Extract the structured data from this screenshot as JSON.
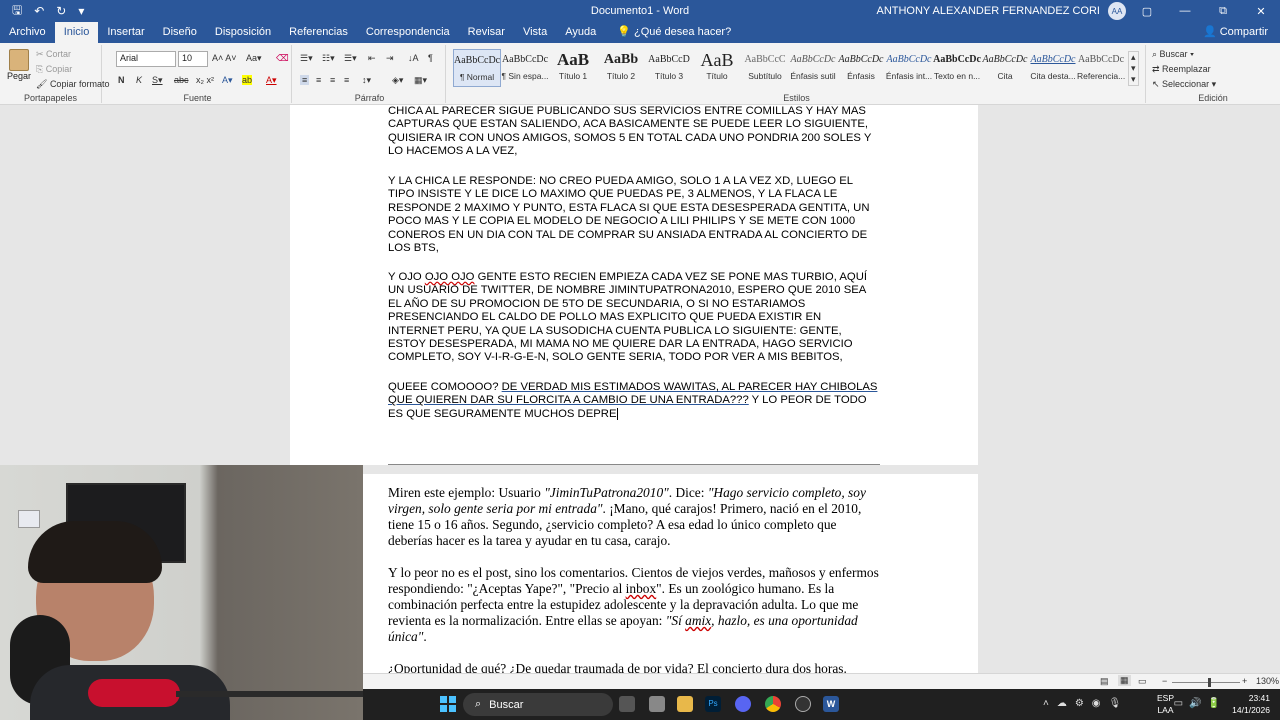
{
  "window": {
    "title": "Documento1 - Word",
    "user": "ANTHONY ALEXANDER FERNANDEZ CORI",
    "avatar": "AA",
    "controls": {
      "restore": "▢",
      "minimize": "—",
      "maximize": "⧉",
      "close": "✕"
    }
  },
  "ribbon_tabs": [
    "Archivo",
    "Inicio",
    "Insertar",
    "Diseño",
    "Disposición",
    "Referencias",
    "Correspondencia",
    "Revisar",
    "Vista",
    "Ayuda"
  ],
  "tell_me": "¿Qué desea hacer?",
  "share": "Compartir",
  "clipboard": {
    "paste": "Pegar",
    "cut": "Cortar",
    "copy": "Copiar",
    "format_painter": "Copiar formato",
    "label": "Portapapeles"
  },
  "font": {
    "name": "Arial",
    "size": "10",
    "label": "Fuente"
  },
  "paragraph": {
    "label": "Párrafo"
  },
  "styles": {
    "label": "Estilos",
    "items": [
      {
        "preview": "AaBbCcDc",
        "name": "¶ Normal"
      },
      {
        "preview": "AaBbCcDc",
        "name": "¶ Sin espa..."
      },
      {
        "preview": "AaB",
        "name": "Título 1"
      },
      {
        "preview": "AaBb",
        "name": "Título 2"
      },
      {
        "preview": "AaBbCcD",
        "name": "Título 3"
      },
      {
        "preview": "AaB",
        "name": "Título"
      },
      {
        "preview": "AaBbCcC",
        "name": "Subtítulo"
      },
      {
        "preview": "AaBbCcDc",
        "name": "Énfasis sutil"
      },
      {
        "preview": "AaBbCcDc",
        "name": "Énfasis"
      },
      {
        "preview": "AaBbCcDc",
        "name": "Énfasis int..."
      },
      {
        "preview": "AaBbCcDc",
        "name": "Texto en n..."
      },
      {
        "preview": "AaBbCcDc",
        "name": "Cita"
      },
      {
        "preview": "AaBbCcDc",
        "name": "Cita desta..."
      },
      {
        "preview": "AaBbCcDc",
        "name": "Referencia..."
      }
    ]
  },
  "editing": {
    "find": "Buscar",
    "replace": "Reemplazar",
    "select": "Seleccionar",
    "label": "Edición"
  },
  "page1": {
    "para1": "CHICA AL PARECER SIGUE PUBLICANDO SUS SERVICIOS ENTRE COMILLAS Y HAY MAS CAPTURAS QUE ESTAN SALIENDO, ACA BASICAMENTE SE PUEDE LEER LO SIGUIENTE, QUISIERA IR CON UNOS AMIGOS, SOMOS 5 EN TOTAL CADA UNO PONDRIA 200 SOLES Y LO HACEMOS A LA VEZ,",
    "para2": "Y LA CHICA LE RESPONDE: NO CREO PUEDA AMIGO, SOLO 1 A LA VEZ XD, LUEGO EL TIPO INSISTE Y LE DICE LO MAXIMO QUE PUEDAS PE, 3 ALMENOS, Y LA FLACA LE RESPONDE 2 MAXIMO Y PUNTO, ESTA FLACA SI QUE ESTA DESESPERADA GENTITA, UN POCO MAS Y LE COPIA EL MODELO DE NEGOCIO A LILI PHILIPS Y SE METE CON 1000 CONEROS EN UN DIA CON TAL DE COMPRAR SU ANSIADA ENTRADA AL CONCIERTO DE LOS BTS,",
    "para3a": "Y OJO ",
    "para3b": "OJO OJO",
    "para3c": " GENTE ESTO RECIEN EMPIEZA CADA VEZ SE PONE MAS TURBIO, AQUÍ UN USUARIO DE TWITTER, DE NOMBRE JIMINTUPATRONA2010, ESPERO QUE 2010 SEA EL AÑO DE SU PROMOCION DE 5TO DE SECUNDARIA, O SI NO ESTARIAMOS PRESENCIANDO EL CALDO DE POLLO MAS EXPLICITO QUE PUEDA EXISTIR EN INTERNET PERU, YA QUE LA SUSODICHA CUENTA PUBLICA LO SIGUIENTE: GENTE, ESTOY DESESPERADA,  MI MAMA NO ME QUIERE DAR LA ENTRADA, HAGO SERVICIO COMPLETO, SOY V-I-R-G-E-N, SOLO GENTE SERIA, TODO POR VER A MIS BEBITOS,",
    "para4a": "QUEEE COMOOOO? ",
    "para4b": "DE VERDAD MIS ESTIMADOS WAWITAS, AL PARECER HAY CHIBOLAS QUE QUIEREN DAR SU FLORCITA A CAMBIO DE UNA ENTRADA???",
    "para4c": " Y LO PEOR DE TODO ES QUE SEGURAMENTE MUCHOS DEPRE"
  },
  "page2": {
    "p1a": "Miren este ejemplo: Usuario ",
    "p1b": "\"JiminTuPatrona2010\"",
    "p1c": ". Dice: ",
    "p1d": "\"Hago servicio completo, soy virgen, solo gente seria por mi entrada\"",
    "p1e": ". ¡Mano, qué carajos! Primero, nació en el 2010, tiene 15 o 16 años. Segundo, ¿servicio completo? A esa edad lo único completo que deberías hacer es la tarea y ayudar en tu casa, carajo.",
    "p2a": "Y lo peor no es el post, sino los comentarios. Cientos de viejos verdes, mañosos y enfermos respondiendo: \"¿Aceptas Yape?\", \"Precio al ",
    "p2b": "inbox",
    "p2c": "\". Es un zoológico humano. Es la combinación perfecta entre la estupidez adolescente y la depravación adulta. Lo que me revienta es la normalización. Entre ellas se apoyan: ",
    "p2d": "\"Sí ",
    "p2e": "amix",
    "p2f": ", hazlo, es una oportunidad única\"",
    "p2g": ".",
    "p3": "¿Oportunidad de qué? ¿De quedar traumada de por vida? El concierto dura dos horas."
  },
  "status": {
    "zoom": "130%"
  },
  "taskbar": {
    "search": "Buscar",
    "lang1": "ESP",
    "lang2": "LAA",
    "time": "23:41",
    "date": "14/1/2026"
  }
}
